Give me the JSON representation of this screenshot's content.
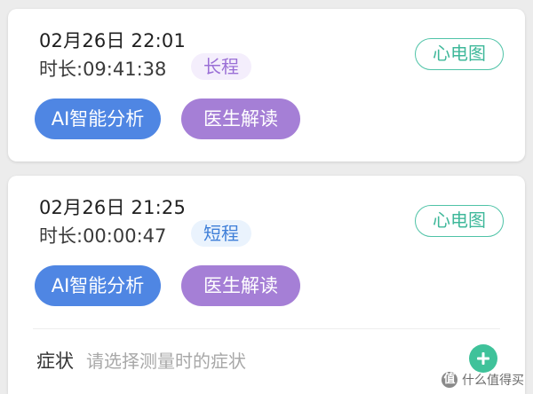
{
  "records": [
    {
      "datetime": "02月26日 22:01",
      "duration": "时长:09:41:38",
      "type_tag": "长程",
      "ecg_label": "心电图",
      "ai_label": "AI智能分析",
      "doctor_label": "医生解读"
    },
    {
      "datetime": "02月26日 21:25",
      "duration": "时长:00:00:47",
      "type_tag": "短程",
      "ecg_label": "心电图",
      "ai_label": "AI智能分析",
      "doctor_label": "医生解读",
      "symptom_label": "症状",
      "symptom_placeholder": "请选择测量时的症状"
    }
  ],
  "watermark": {
    "logo_char": "值",
    "text": "什么值得买"
  },
  "colors": {
    "ai_button": "#4f86e3",
    "doctor_button": "#a57fd6",
    "ecg_outline": "#4fc3a7",
    "add_button": "#3fc29a",
    "tag_long_text": "#9a6fd6",
    "tag_short_text": "#3f7fd8"
  },
  "icons": {
    "add": "plus-icon",
    "watermark_logo": "smzdm-logo-icon"
  }
}
